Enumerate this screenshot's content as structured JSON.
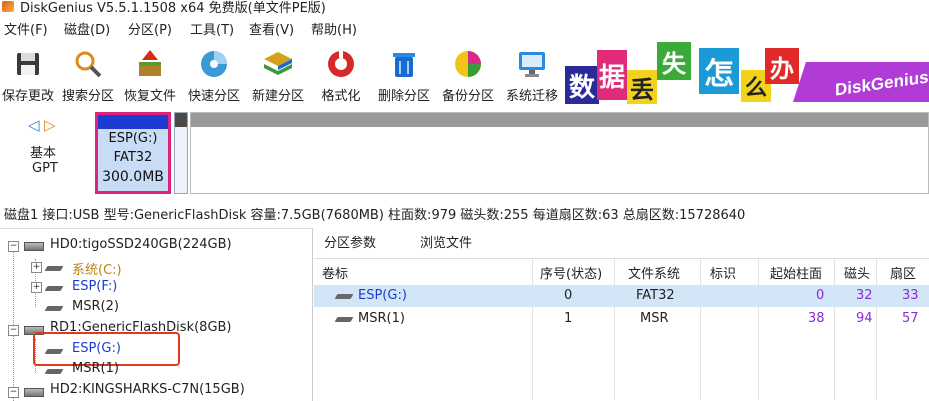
{
  "window": {
    "title": "DiskGenius V5.5.1.1508 x64 免费版(单文件PE版)"
  },
  "menu": [
    "文件(F)",
    "磁盘(D)",
    "分区(P)",
    "工具(T)",
    "查看(V)",
    "帮助(H)"
  ],
  "toolbar": [
    "保存更改",
    "搜索分区",
    "恢复文件",
    "快速分区",
    "新建分区",
    "格式化",
    "删除分区",
    "备份分区",
    "系统迁移"
  ],
  "banner": {
    "chars": [
      "数",
      "据",
      "丢",
      "失",
      "怎",
      "么",
      "办"
    ],
    "brand": "DiskGenius"
  },
  "diskmap": {
    "disk_type_1": "基本",
    "disk_type_2": "GPT",
    "selected_partition": {
      "name": "ESP(G:)",
      "fs": "FAT32",
      "size": "300.0MB"
    }
  },
  "disk_info": "磁盘1 接口:USB  型号:GenericFlashDisk  容量:7.5GB(7680MB)  柱面数:979  磁头数:255  每道扇区数:63  总扇区数:15728640",
  "tree": {
    "hd0": "HD0:tigoSSD240GB(224GB)",
    "hd0_parts": [
      "系统(C:)",
      "ESP(F:)",
      "MSR(2)"
    ],
    "rd1": "RD1:GenericFlashDisk(8GB)",
    "rd1_parts": [
      "ESP(G:)",
      "MSR(1)"
    ],
    "hd2": "HD2:KINGSHARKS-C7N(15GB)"
  },
  "tabs": [
    "分区参数",
    "浏览文件"
  ],
  "table": {
    "headers": [
      "卷标",
      "序号(状态)",
      "文件系统",
      "标识",
      "起始柱面",
      "磁头",
      "扇区"
    ],
    "rows": [
      {
        "label": "ESP(G:)",
        "index": "0",
        "fs": "FAT32",
        "id": "",
        "start_cyl": "0",
        "head": "32",
        "sector": "33"
      },
      {
        "label": "MSR(1)",
        "index": "1",
        "fs": "MSR",
        "id": "",
        "start_cyl": "38",
        "head": "94",
        "sector": "57"
      }
    ]
  },
  "colors": {
    "accent_blue": "#1c3bd1",
    "highlight": "#e0237a",
    "red_box": "#e03a1e",
    "brand_purple": "#b13bd6"
  }
}
